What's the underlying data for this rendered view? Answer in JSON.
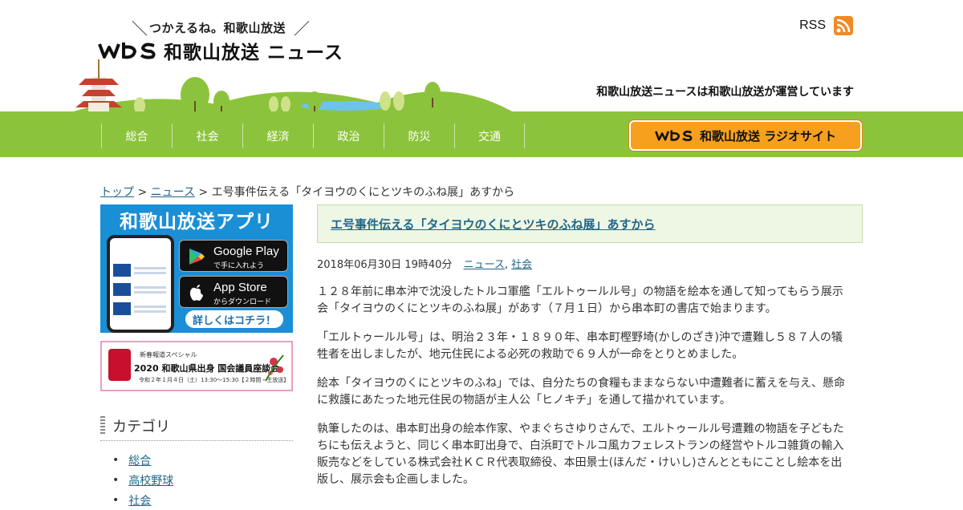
{
  "header": {
    "tagline": "つかえるね。和歌山放送",
    "logo_mark": "wbs",
    "logo_text": "和歌山放送 ニュース",
    "rss_label": "RSS",
    "operator_note": "和歌山放送ニュースは和歌山放送が運営しています",
    "radio_site_label": "和歌山放送 ラジオサイト"
  },
  "nav": {
    "items": [
      "総合",
      "社会",
      "経済",
      "政治",
      "防災",
      "交通"
    ]
  },
  "breadcrumb": {
    "top": "トップ",
    "sep": ">",
    "news": "ニュース",
    "current": "エ号事件伝える「タイヨウのくにとツキのふね展」あすから"
  },
  "sidebar": {
    "app_banner": {
      "title": "和歌山放送アプリ",
      "google_title": "Google Play",
      "google_sub": "で手に入れよう",
      "apple_title": "App Store",
      "apple_sub": "からダウンロード",
      "more": "詳しくはコチラ！"
    },
    "event_banner": {
      "small": "新春報道スペシャル",
      "title": "2020 和歌山県出身 国会議員座談会",
      "date": "令和２年１月４日（土）13:30〜15:30【２時間・生放送】"
    },
    "category_title": "カテゴリ",
    "categories": [
      "総合",
      "高校野球",
      "社会"
    ]
  },
  "article": {
    "title": "エ号事件伝える「タイヨウのくにとツキのふね展」あすから",
    "date": "2018年06月30日 19時40分",
    "tags": [
      "ニュース",
      "社会"
    ],
    "paragraphs": [
      "１２８年前に串本沖で沈没したトルコ軍艦「エルトゥールル号」の物語を絵本を通して知ってもらう展示会「タイヨウのくにとツキのふね展」があす（７月１日）から串本町の書店で始まります。",
      "「エルトゥールル号」は、明治２３年・１８９０年、串本町樫野埼(かしのざき)沖で遭難し５８７人の犠牲者を出しましたが、地元住民による必死の救助で６９人が一命をとりとめました。",
      "絵本「タイヨウのくにとツキのふね」では、自分たちの食糧もままならない中遭難者に蓄えを与え、懸命に救護にあたった地元住民の物語が主人公「ヒノキチ」を通して描かれています。",
      "執筆したのは、串本町出身の絵本作家、やまぐちさゆりさんで、エルトゥールル号遭難の物語を子どもたちにも伝えようと、同じく串本町出身で、白浜町でトルコ風カフェレストランの経営やトルコ雑貨の輸入販売などをしている株式会社ＫＣＲ代表取締役、本田景士(ほんだ・けいし)さんとともにことし絵本を出版し、展示会も企画しました。"
    ]
  },
  "colors": {
    "nav_green": "#8cc33c",
    "link_blue": "#226688",
    "radio_orange": "#f7a01e",
    "app_blue": "#1a8fd6",
    "title_bg": "#eef7e4"
  }
}
